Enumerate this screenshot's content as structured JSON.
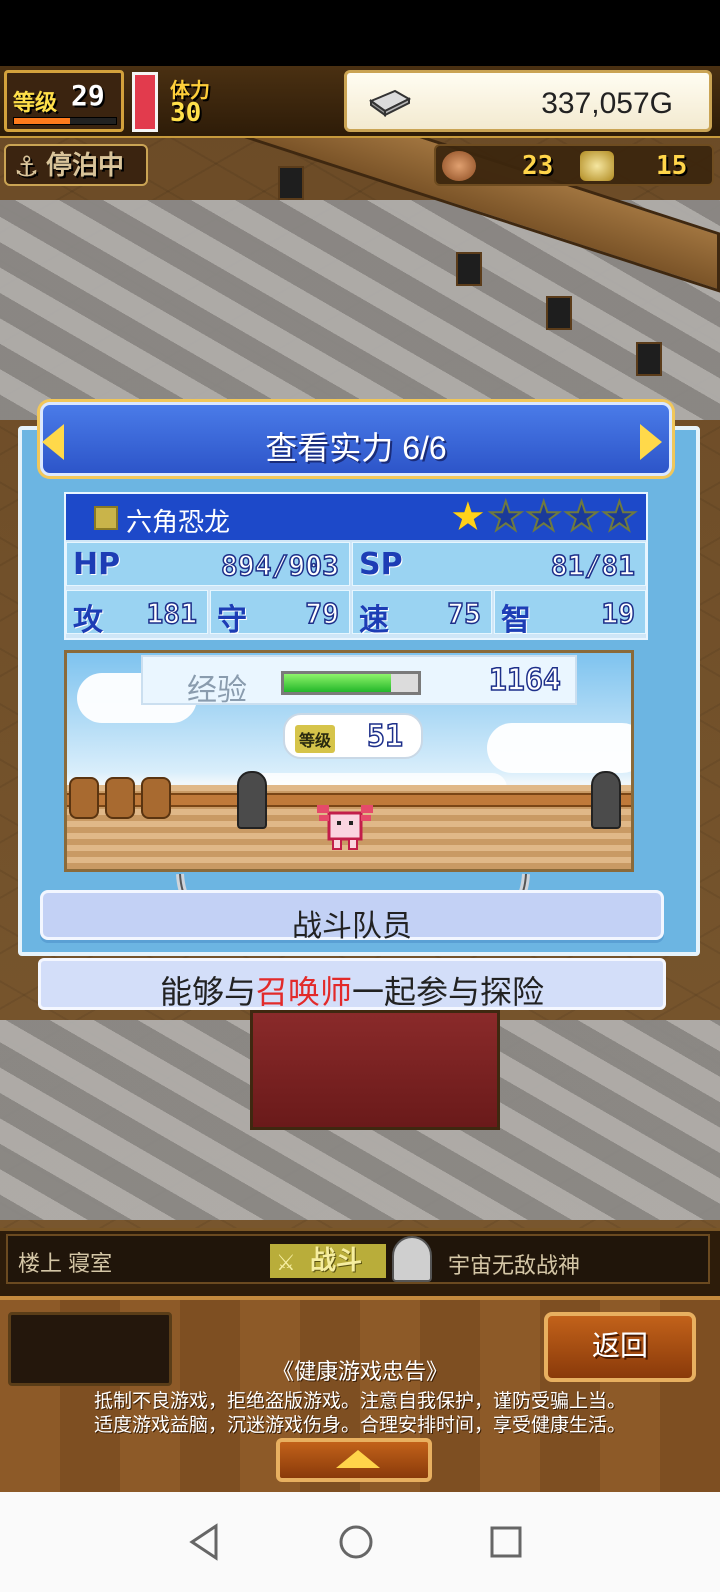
{
  "hud": {
    "level_label": "等级",
    "level": "29",
    "level_progress": 0.55,
    "stamina_label": "体力",
    "stamina": "30",
    "gold": "337,057G",
    "dock_status": "停泊中",
    "resource_food": "23",
    "resource_medal": "15"
  },
  "panel": {
    "title": "查看实力 6/6",
    "monster": {
      "name": "六角恐龙",
      "stars_on": 1,
      "stars_total": 5,
      "hp_label": "HP",
      "hp": "894/903",
      "sp_label": "SP",
      "sp": "81/81",
      "atk_label": "攻",
      "atk": "181",
      "def_label": "守",
      "def": "79",
      "spd_label": "速",
      "spd": "75",
      "int_label": "智",
      "int": "19"
    },
    "exp_label": "经验",
    "exp": "1164",
    "exp_progress": 0.8,
    "level_tag": "等级",
    "level": "51",
    "role": "战斗队员",
    "desc_prefix": "能够与",
    "desc_highlight": "召唤师",
    "desc_suffix": "一起参与探险"
  },
  "status": {
    "location": "楼上 寝室",
    "battle_label": "战斗",
    "title_name": "宇宙无敌战神"
  },
  "bottom": {
    "back_label": "返回",
    "notice_title": "《健康游戏忠告》",
    "notice_line1": "抵制不良游戏，拒绝盗版游戏。注意自我保护，谨防受骗上当。",
    "notice_line2": "适度游戏益脑，沉迷游戏伤身。合理安排时间，享受健康生活。"
  },
  "colors": {
    "accent_blue": "#2d55c9",
    "highlight_red": "#e22a2a",
    "gold_yellow": "#ffd94a"
  }
}
